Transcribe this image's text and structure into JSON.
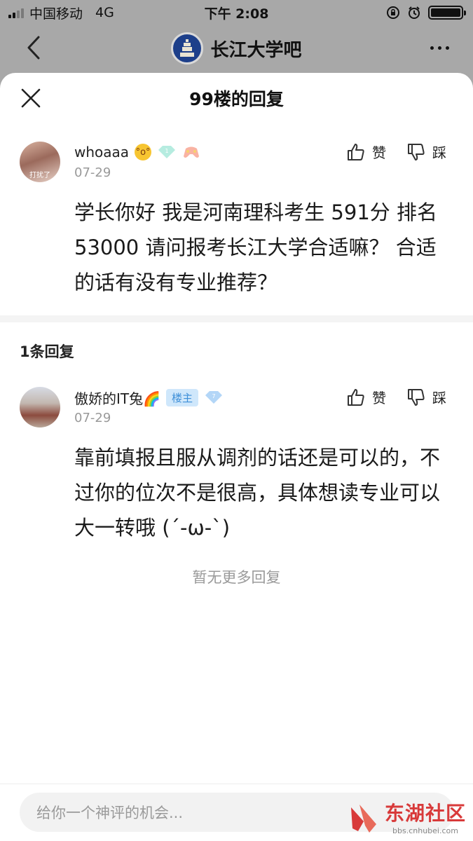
{
  "status_bar": {
    "carrier": "中国移动",
    "network": "4G",
    "time": "下午 2:08"
  },
  "nav": {
    "title": "长江大学吧",
    "back_icon": "chevron-left-icon",
    "more_icon": "more-dots-icon"
  },
  "sheet": {
    "title": "99楼的回复",
    "close_icon": "close-icon"
  },
  "main_post": {
    "username": "whoaaa",
    "avatar_text": "打扰了",
    "level": "1",
    "date": "07-29",
    "like_label": "赞",
    "dislike_label": "踩",
    "content": "学长你好 我是河南理科考生 591分 排名53000 请问报考长江大学合适嘛？ 合适的话有没有专业推荐？"
  },
  "reply_count": "1条回复",
  "replies": [
    {
      "username": "傲娇的IT兔🌈",
      "badge": "楼主",
      "level": "7",
      "date": "07-29",
      "like_label": "赞",
      "dislike_label": "踩",
      "content": "靠前填报且服从调剂的话还是可以的，不过你的位次不是很高，具体想读专业可以大一转哦 (´-ω-`)"
    }
  ],
  "no_more": "暂无更多回复",
  "comment_input": {
    "placeholder": "给你一个神评的机会..."
  },
  "watermark": {
    "name": "东湖社区",
    "url": "bbs.cnhubei.com"
  },
  "colors": {
    "overlay": "#a8a8a8",
    "badge_bg": "#cfe7fb",
    "badge_text": "#3e8fd8",
    "watermark": "#d83a3a"
  }
}
